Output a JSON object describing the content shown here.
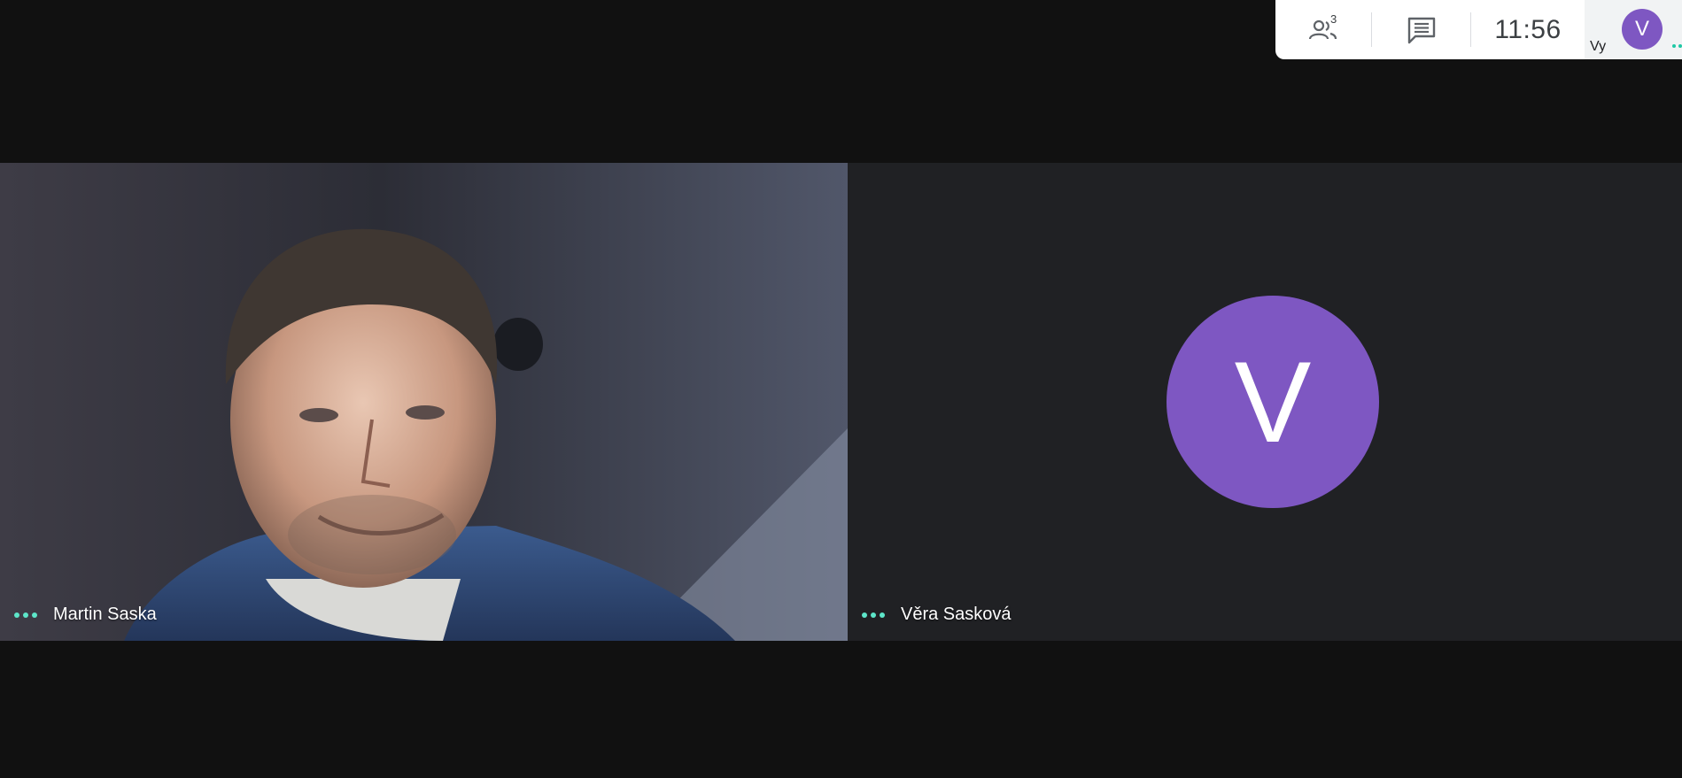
{
  "topbar": {
    "people_count": "3",
    "people_icon": "people-icon",
    "chat_icon": "chat-icon",
    "time": "11:56",
    "self_label": "Vy",
    "self_avatar_letter": "V"
  },
  "participants": [
    {
      "name": "Martin Saska",
      "type": "video",
      "menu_icon": "more-dots-icon"
    },
    {
      "name": "Věra Sasková",
      "type": "avatar",
      "avatar_letter": "V",
      "avatar_color": "#7e57c2",
      "menu_icon": "more-dots-icon"
    }
  ],
  "colors": {
    "background": "#111111",
    "avatar": "#7e57c2",
    "indicator": "#5de6c9"
  }
}
